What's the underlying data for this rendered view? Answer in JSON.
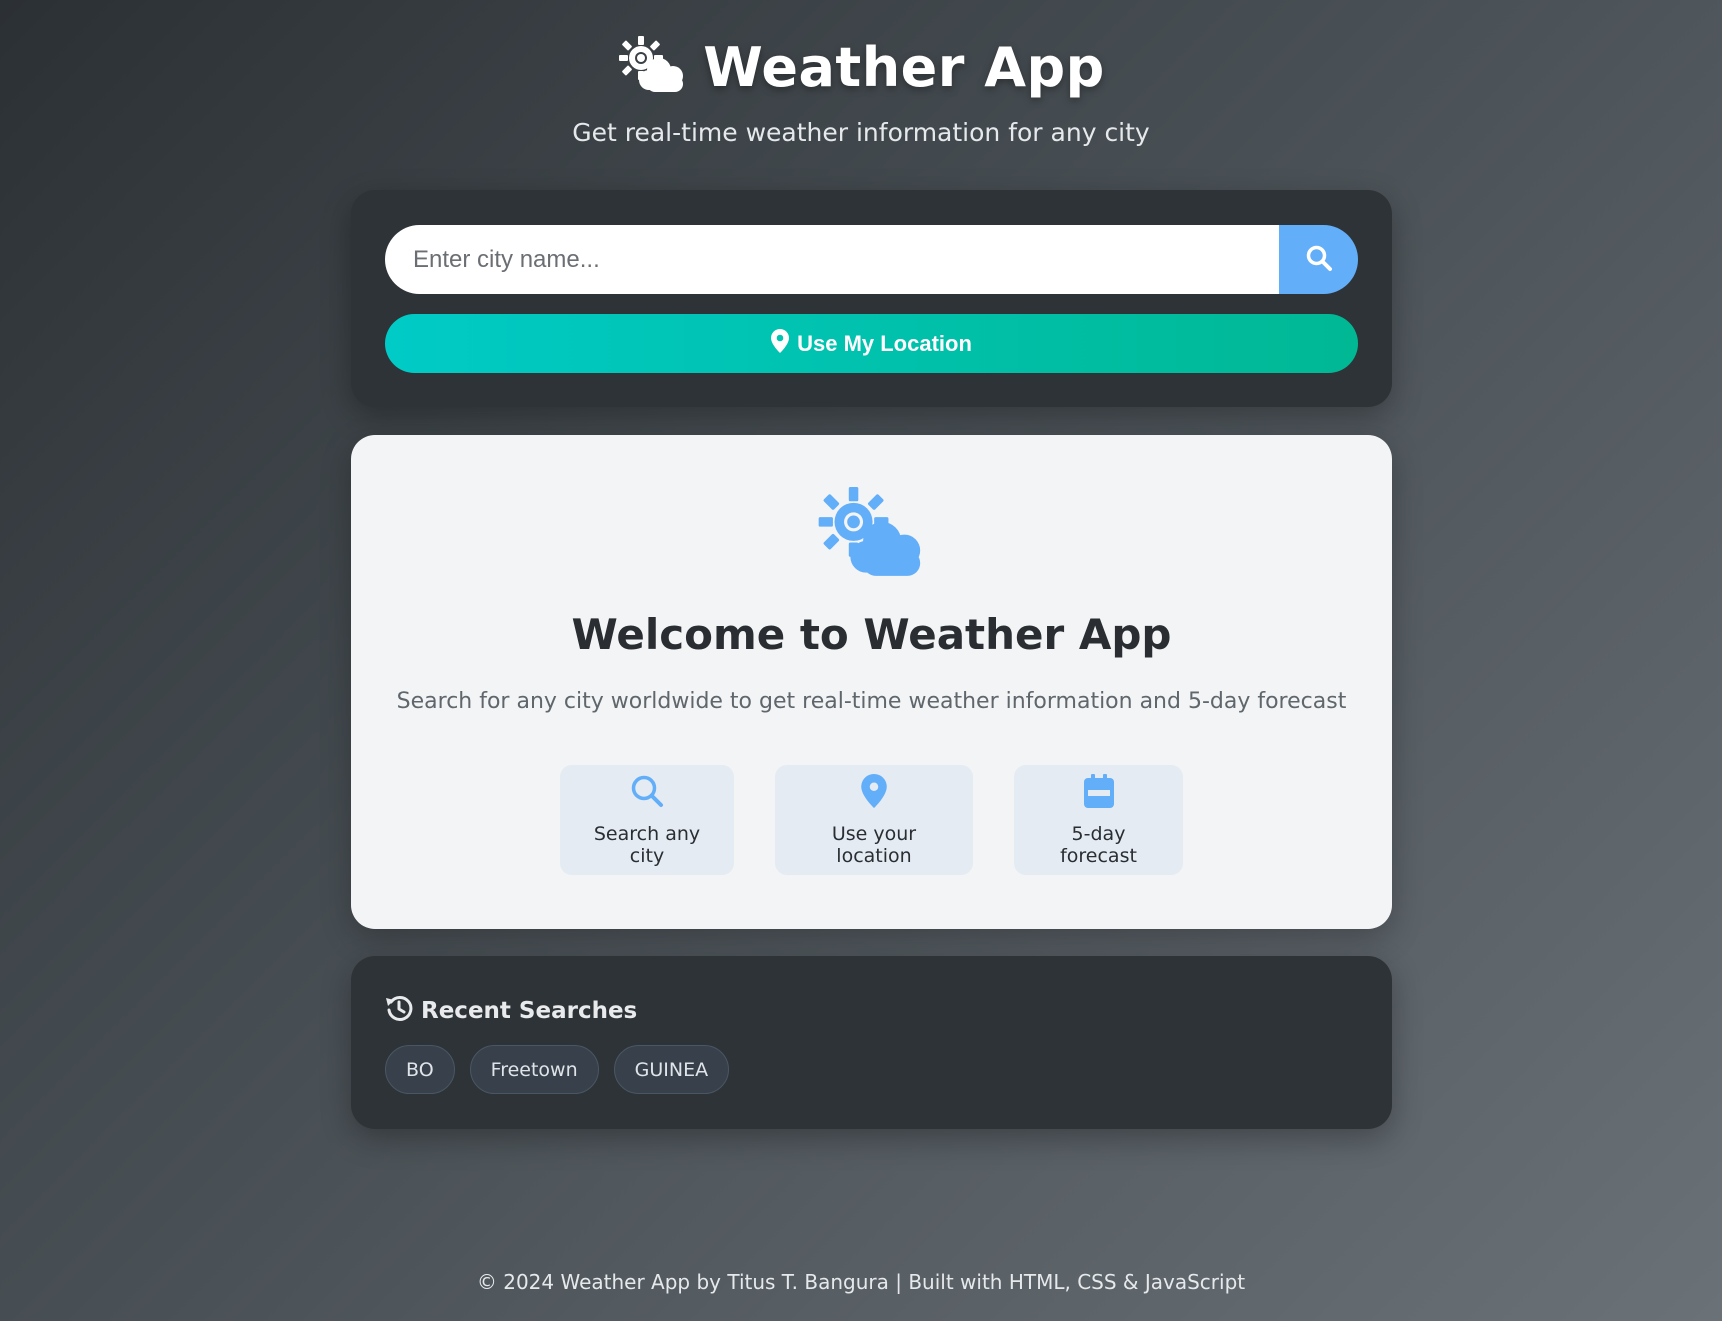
{
  "header": {
    "title": "Weather App",
    "subtitle": "Get real-time weather information for any city",
    "logo_icon": "sun-cloud-icon"
  },
  "search": {
    "placeholder": "Enter city name...",
    "value": "",
    "search_icon": "search-icon",
    "location_label": "Use My Location",
    "location_icon": "map-pin-icon"
  },
  "welcome": {
    "icon": "sun-cloud-icon",
    "title": "Welcome to Weather App",
    "description": "Search for any city worldwide to get real-time weather information and 5-day forecast",
    "features": [
      {
        "label": "Search any city",
        "icon": "search-icon"
      },
      {
        "label": "Use your location",
        "icon": "map-pin-icon"
      },
      {
        "label": "5-day forecast",
        "icon": "calendar-icon"
      }
    ]
  },
  "recent": {
    "title": "Recent Searches",
    "icon": "history-icon",
    "items": [
      "BO",
      "Freetown",
      "GUINEA"
    ]
  },
  "footer": {
    "text": "© 2024 Weather App by Titus T. Bangura | Built with HTML, CSS & JavaScript"
  },
  "colors": {
    "accent_blue": "#62aef9",
    "accent_teal": "#00cbc6",
    "accent_green": "#00b894",
    "card_dark": "#2e3337",
    "card_light": "#f3f4f5"
  }
}
